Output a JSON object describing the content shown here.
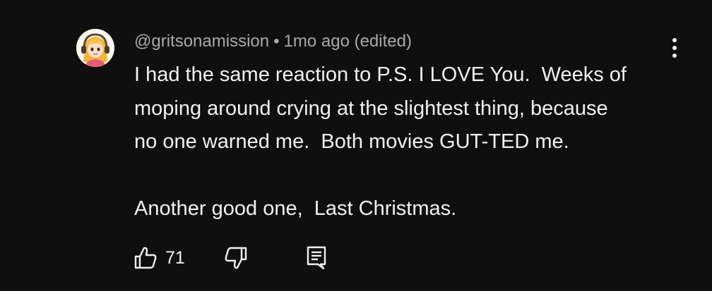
{
  "comment": {
    "author": "@gritsonamission",
    "separator": "•",
    "timestamp": "1mo ago (edited)",
    "text_lines": [
      "I had the same reaction to P.S. I LOVE You.  Weeks of",
      "moping around crying at the slightest thing, because",
      "no one warned me.  Both movies GUT-TED me.",
      "",
      "Another good one,  Last Christmas."
    ],
    "like_count": "71"
  },
  "icons": {
    "avatar": "cartoon-girl-with-headphones",
    "more": "three-dots-vertical-icon",
    "like": "thumbs-up-icon",
    "dislike": "thumbs-down-icon",
    "reply": "comment-reply-icon"
  },
  "colors": {
    "background": "#0f0f0f",
    "text": "#f1f1f1",
    "secondary_text": "#aaaaaa"
  }
}
